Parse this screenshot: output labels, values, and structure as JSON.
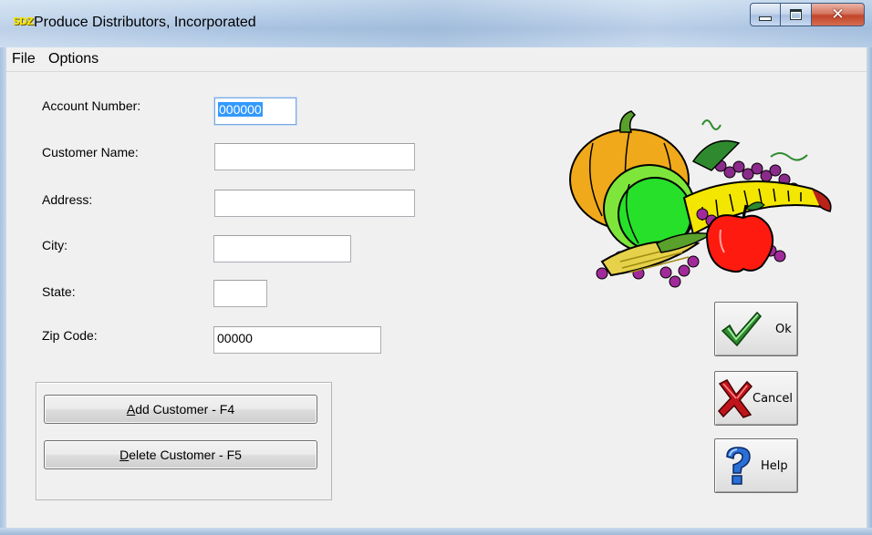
{
  "window": {
    "title": "Produce Distributors, Incorporated",
    "app_icon_text": "SDZ"
  },
  "menu": {
    "items": [
      "File",
      "Options"
    ]
  },
  "form": {
    "account_number": {
      "label": "Account Number:",
      "value": "000000"
    },
    "customer_name": {
      "label": "Customer Name:",
      "value": ""
    },
    "address": {
      "label": "Address:",
      "value": ""
    },
    "city": {
      "label": "City:",
      "value": ""
    },
    "state": {
      "label": "State:",
      "value": ""
    },
    "zip_code": {
      "label": "Zip Code:",
      "value": "00000"
    }
  },
  "actions": {
    "add_customer": {
      "mnemonic": "A",
      "rest": "dd Customer - F4"
    },
    "delete_customer": {
      "mnemonic": "D",
      "rest": "elete Customer - F5"
    }
  },
  "buttons": {
    "ok": "Ok",
    "cancel": "Cancel",
    "help": "Help"
  },
  "colors": {
    "selection": "#3399ff",
    "ok_check": "#2e8b2e",
    "cancel_x": "#c0141c",
    "help_q": "#2a6fd6"
  },
  "icons": {
    "logo": "produce-cornucopia-image",
    "ok": "green-checkmark-icon",
    "cancel": "red-x-icon",
    "help": "blue-question-mark-icon"
  }
}
